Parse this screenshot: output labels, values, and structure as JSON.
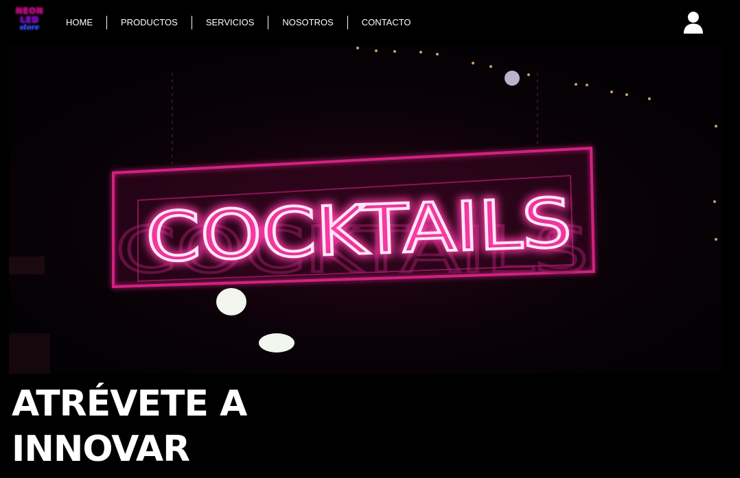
{
  "brand": {
    "logo_line1": "NEON",
    "logo_line2": "LED",
    "logo_line3": "store"
  },
  "nav": {
    "items": [
      {
        "label": "HOME"
      },
      {
        "label": "PRODUCTOS"
      },
      {
        "label": "SERVICIOS"
      },
      {
        "label": "NOSOTROS"
      },
      {
        "label": "CONTACTO"
      }
    ],
    "user_icon": "user-icon"
  },
  "hero": {
    "sign_text": "COCKTAILS",
    "sign_color": "#d0237f",
    "tube_color": "#ffe8f6"
  },
  "headline": {
    "line1": "ATRÉVETE A",
    "line2": "INNOVAR"
  },
  "colors": {
    "background": "#000000",
    "text": "#ffffff"
  }
}
